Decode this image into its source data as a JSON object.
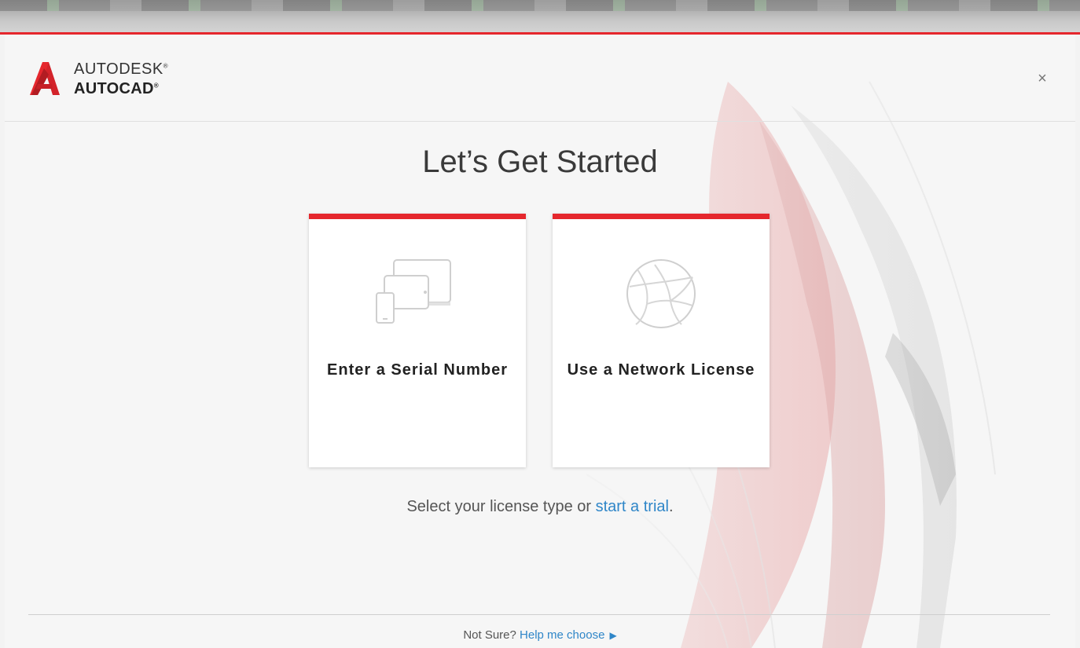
{
  "brand": {
    "company": "AUTODESK",
    "product": "AUTOCAD",
    "reg_mark": "®"
  },
  "header": {
    "close_label": "×"
  },
  "main": {
    "title": "Let’s Get Started",
    "cards": [
      {
        "label": "Enter a Serial Number",
        "icon": "devices-icon"
      },
      {
        "label": "Use a Network License",
        "icon": "network-globe-icon"
      }
    ],
    "subtitle_prefix": "Select your license type or ",
    "subtitle_link": "start a trial",
    "subtitle_suffix": "."
  },
  "footer": {
    "prefix": "Not Sure? ",
    "link": "Help me choose",
    "arrow": "▶"
  },
  "colors": {
    "accent_red": "#e5272d",
    "link_blue": "#2f86c8"
  }
}
